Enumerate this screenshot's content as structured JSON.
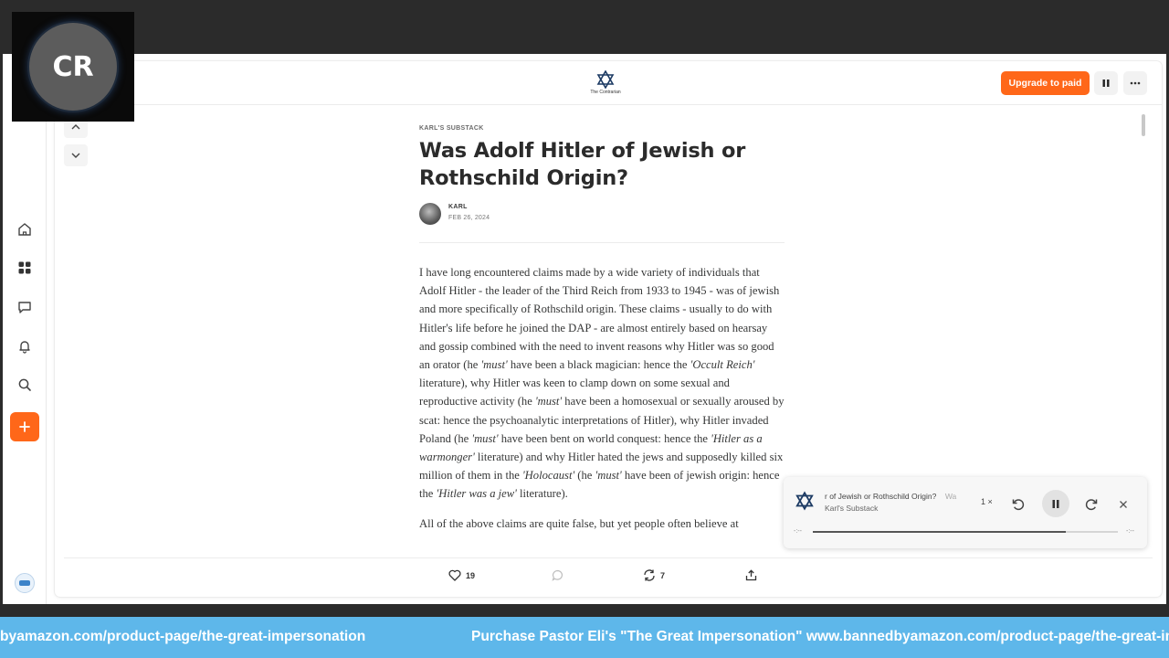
{
  "webcam": {
    "initials": "CR"
  },
  "header": {
    "publication_logo_text": "The Contrarian",
    "upgrade_label": "Upgrade to paid"
  },
  "article": {
    "kicker": "KARL'S SUBSTACK",
    "title": "Was Adolf Hitler of Jewish or Rothschild Origin?",
    "author": "KARL",
    "date": "FEB 26, 2024",
    "p1": [
      {
        "t": "I have long encountered claims made by a wide variety of individuals that Adolf Hitler - the leader of the Third Reich from 1933 to 1945 - was of jewish and more specifically of Rothschild origin. These claims - usually to do with Hitler's life before he joined the DAP - are almost entirely based on hearsay and gossip combined with the need to invent reasons why Hitler was so good an orator (he "
      },
      {
        "t": "'must'",
        "em": true
      },
      {
        "t": " have been a black magician: hence the "
      },
      {
        "t": "'Occult Reich'",
        "em": true
      },
      {
        "t": " literature), why Hitler was keen to clamp down on some sexual and reproductive activity (he "
      },
      {
        "t": "'must'",
        "em": true
      },
      {
        "t": " have been a homosexual or sexually aroused by scat: hence the psychoanalytic interpretations of Hitler), why Hitler invaded Poland (he "
      },
      {
        "t": "'must'",
        "em": true
      },
      {
        "t": " have been bent on world conquest: hence the "
      },
      {
        "t": "'Hitler as a warmonger'",
        "em": true
      },
      {
        "t": " literature) and why Hitler hated the jews and supposedly killed six million of them in the "
      },
      {
        "t": "'Holocaust'",
        "em": true
      },
      {
        "t": " (he "
      },
      {
        "t": "'must'",
        "em": true
      },
      {
        "t": " have been of jewish origin: hence the "
      },
      {
        "t": "'Hitler was a jew'",
        "em": true
      },
      {
        "t": " literature)."
      }
    ],
    "p2": "All of the above claims are quite false, but yet people often believe at"
  },
  "footer": {
    "likes": "19",
    "restacks": "7"
  },
  "player": {
    "title": "r of Jewish or Rothschild Origin?",
    "title_tail": "Wa",
    "subtitle": "Karl's Substack",
    "speed": "1 ×",
    "time_left": "-:--",
    "time_right": "-:--",
    "progress": 0.83
  },
  "ticker": {
    "left_text": "byamazon.com/product-page/the-great-impersonation",
    "right_text": "Purchase Pastor Eli's \"The Great Impersonation\" www.bannedbyamazon.com/product-page/the-great-impe"
  },
  "colors": {
    "accent": "#ff6719",
    "ticker": "#5eb7ea"
  }
}
